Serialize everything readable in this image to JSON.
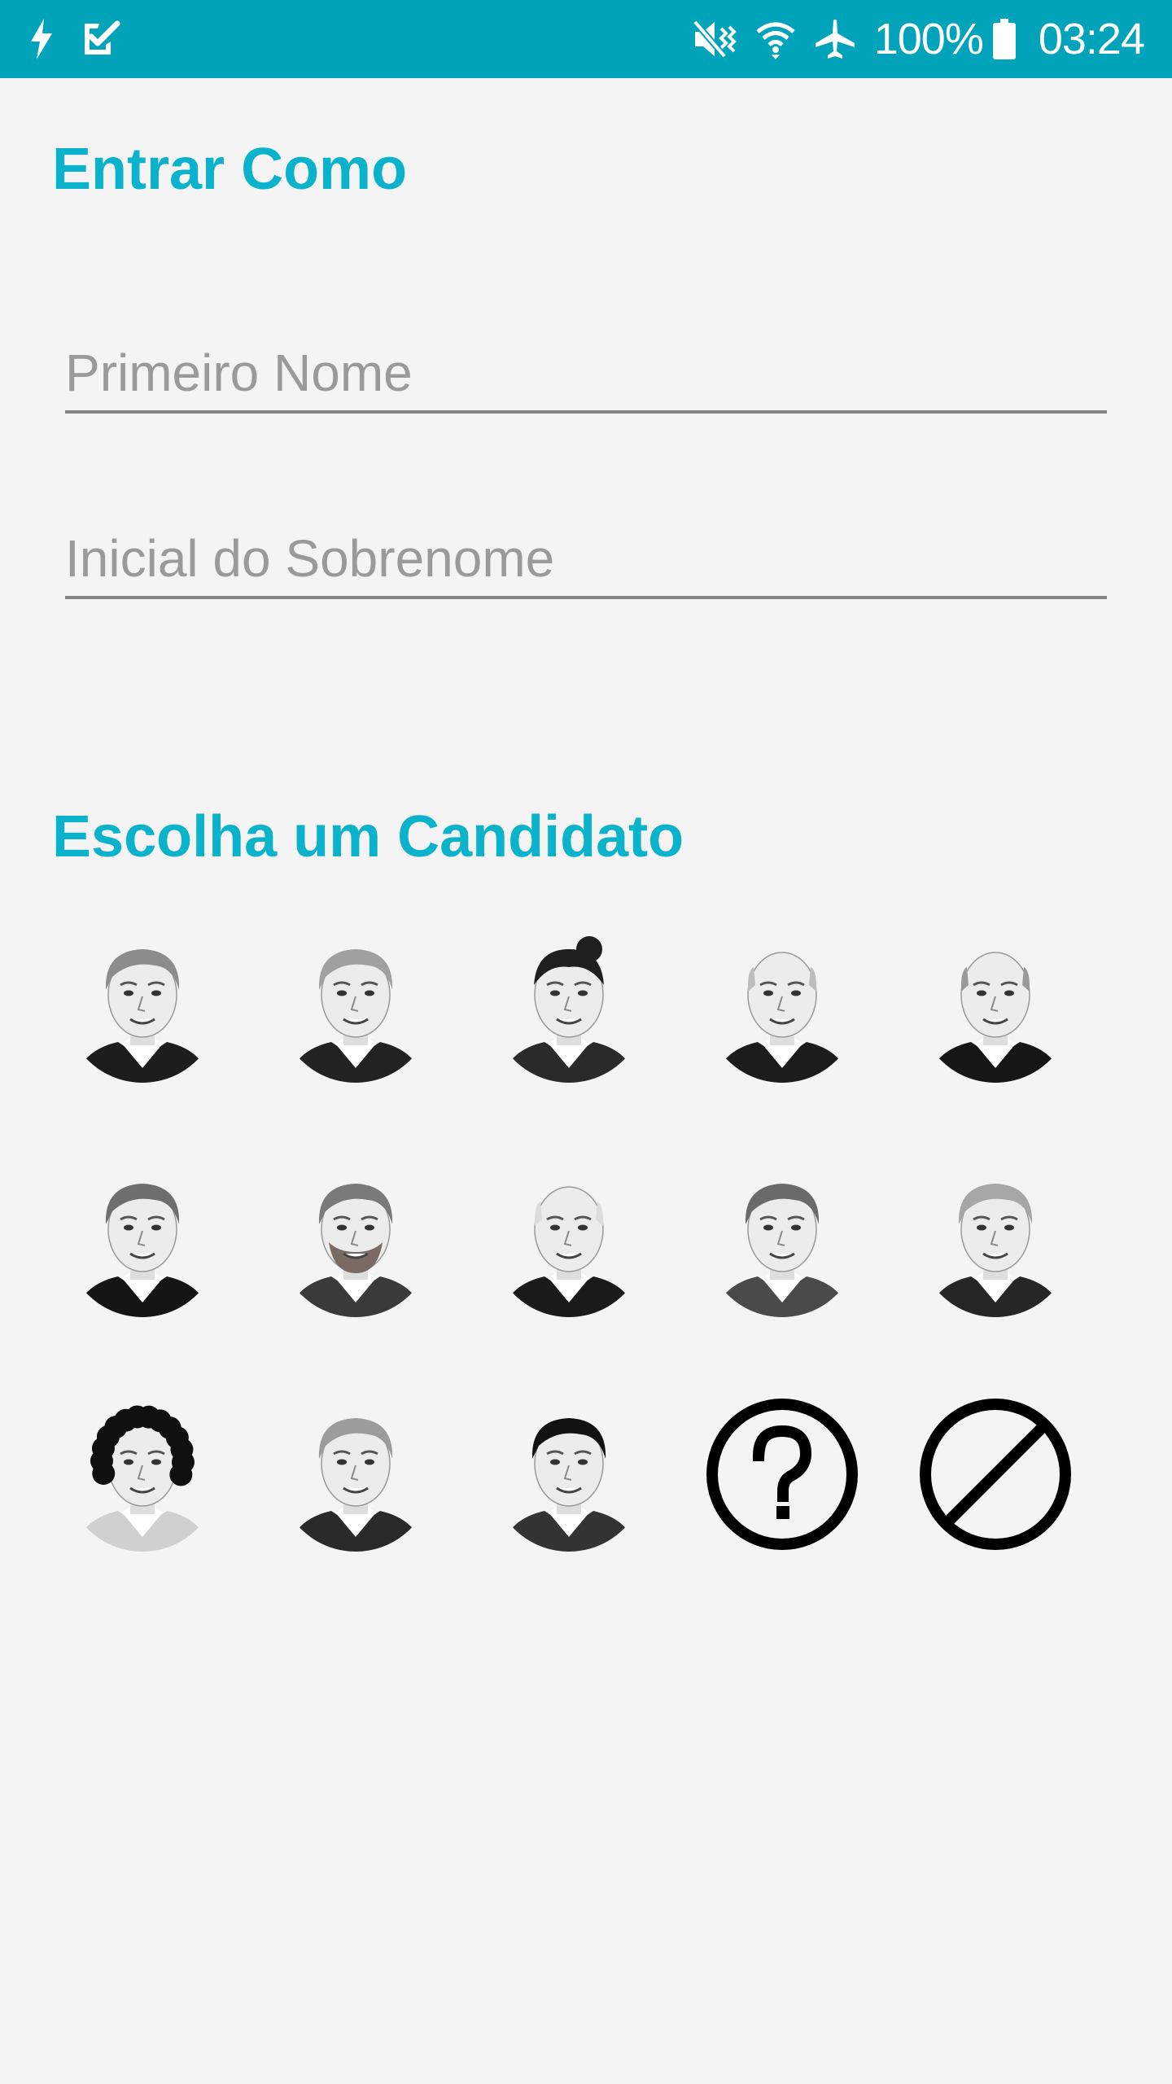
{
  "status_bar": {
    "battery_percent": "100%",
    "time": "03:24",
    "left_icons": [
      "flash-icon",
      "task-check-icon"
    ],
    "right_icons": [
      "vibrate-mute-icon",
      "wifi-icon",
      "airplane-mode-icon",
      "battery-icon"
    ]
  },
  "login": {
    "title": "Entrar Como",
    "first_name": {
      "placeholder": "Primeiro Nome",
      "value": ""
    },
    "last_initial": {
      "placeholder": "Inicial do Sobrenome",
      "value": ""
    }
  },
  "candidates": {
    "title": "Escolha um Candidato",
    "items": [
      {
        "name": "candidate-1",
        "hair": "#8c8c8c",
        "suit": "#1d1d1d",
        "hair_style": "side"
      },
      {
        "name": "candidate-2",
        "hair": "#a0a0a0",
        "suit": "#222222",
        "hair_style": "side"
      },
      {
        "name": "candidate-3",
        "hair": "#1f1f1f",
        "suit": "#2a2a2a",
        "hair_style": "bun"
      },
      {
        "name": "candidate-4",
        "hair": "#bdbdbd",
        "suit": "#1c1c1c",
        "hair_style": "bald"
      },
      {
        "name": "candidate-5",
        "hair": "#9a9a9a",
        "suit": "#161616",
        "hair_style": "bald"
      },
      {
        "name": "candidate-6",
        "hair": "#6e6e6e",
        "suit": "#151515",
        "hair_style": "side"
      },
      {
        "name": "candidate-7",
        "hair": "#7a7a7a",
        "suit": "#3a3a3a",
        "hair_style": "beard"
      },
      {
        "name": "candidate-8",
        "hair": "#dcdcdc",
        "suit": "#1a1a1a",
        "hair_style": "bald"
      },
      {
        "name": "candidate-9",
        "hair": "#6a6a6a",
        "suit": "#4a4a4a",
        "hair_style": "side"
      },
      {
        "name": "candidate-10",
        "hair": "#a6a6a6",
        "suit": "#262626",
        "hair_style": "side"
      },
      {
        "name": "candidate-11",
        "hair": "#101010",
        "suit": "#d0d0d0",
        "hair_style": "curly"
      },
      {
        "name": "candidate-12",
        "hair": "#9c9c9c",
        "suit": "#2a2a2a",
        "hair_style": "side"
      },
      {
        "name": "candidate-13",
        "hair": "#121212",
        "suit": "#333333",
        "hair_style": "short"
      }
    ],
    "unknown_option": {
      "icon": "question-circle-icon"
    },
    "none_option": {
      "icon": "prohibited-circle-icon"
    }
  }
}
